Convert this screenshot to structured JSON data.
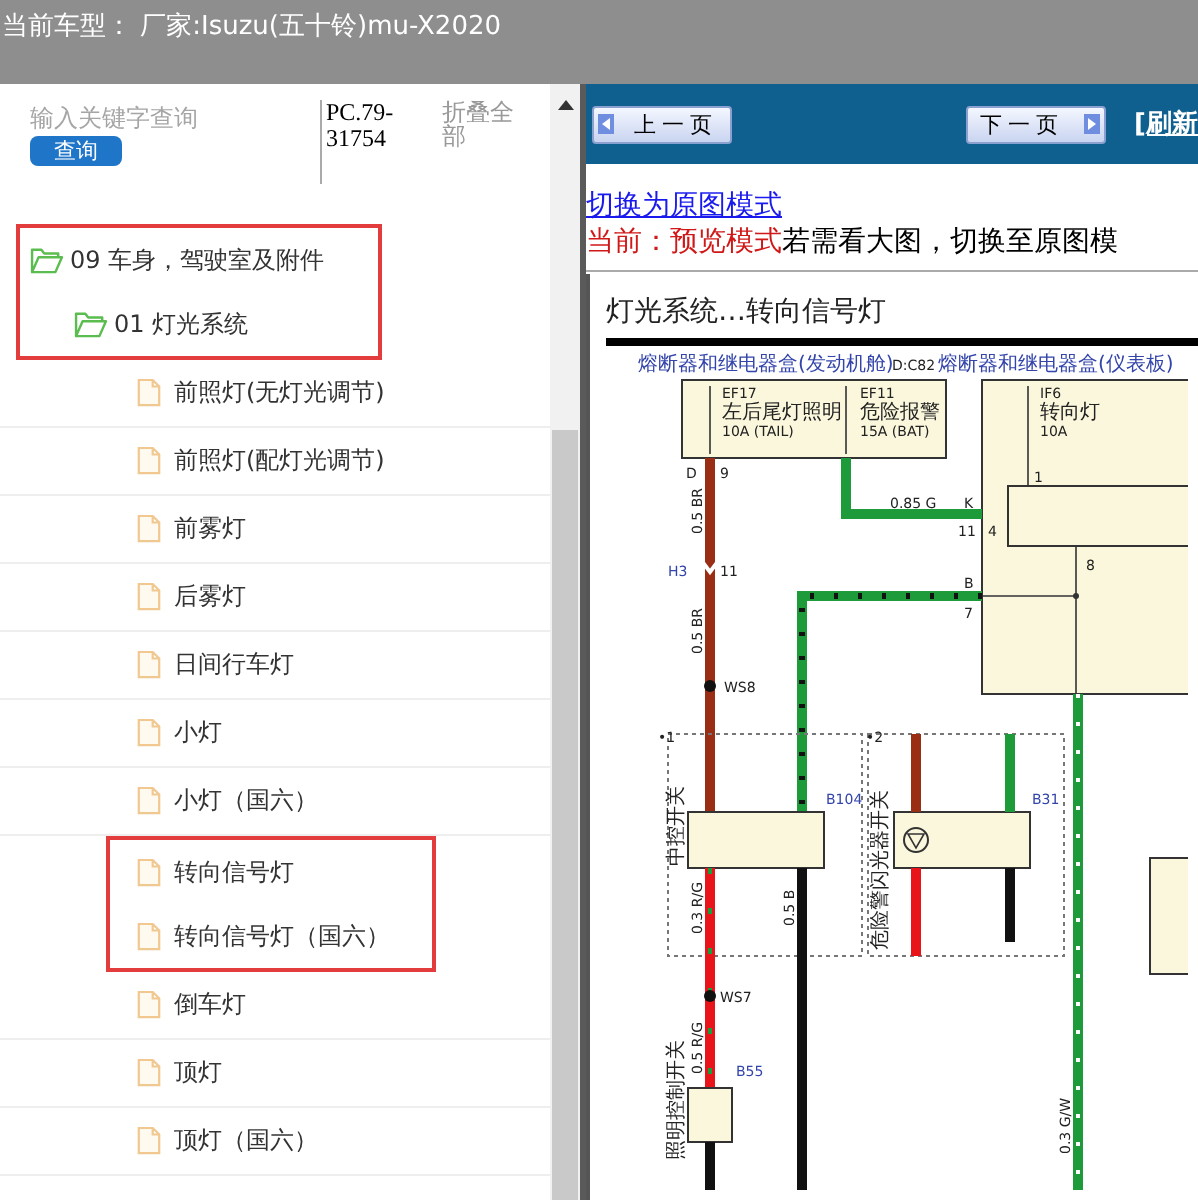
{
  "header": {
    "vehicle": "当前车型：  厂家:Isuzu(五十铃)mu-X2020"
  },
  "search": {
    "placeholder": "输入关键字查询",
    "button": "查询",
    "code": "PC.79-31754",
    "collapse": "折叠全部"
  },
  "tree": [
    {
      "label": "09 车身，驾驶室及附件",
      "kind": "folder",
      "expanded": true,
      "highlighted": true,
      "children": [
        {
          "label": "01 灯光系统",
          "kind": "folder",
          "expanded": true,
          "highlighted": true,
          "children": [
            {
              "label": "前照灯(无灯光调节)",
              "kind": "file",
              "highlighted": false
            },
            {
              "label": "前照灯(配灯光调节)",
              "kind": "file",
              "highlighted": false
            },
            {
              "label": "前雾灯",
              "kind": "file",
              "highlighted": false
            },
            {
              "label": "后雾灯",
              "kind": "file",
              "highlighted": false
            },
            {
              "label": "日间行车灯",
              "kind": "file",
              "highlighted": false
            },
            {
              "label": "小灯",
              "kind": "file",
              "highlighted": false
            },
            {
              "label": "小灯（国六）",
              "kind": "file",
              "highlighted": false
            },
            {
              "label": "转向信号灯",
              "kind": "file",
              "highlighted": true
            },
            {
              "label": "转向信号灯（国六）",
              "kind": "file",
              "highlighted": true
            },
            {
              "label": "倒车灯",
              "kind": "file",
              "highlighted": false
            },
            {
              "label": "顶灯",
              "kind": "file",
              "highlighted": false
            },
            {
              "label": "顶灯（国六）",
              "kind": "file",
              "highlighted": false
            }
          ]
        }
      ]
    }
  ],
  "toolbar": {
    "prev": "上一页",
    "next": "下一页",
    "refresh": "[刷新"
  },
  "mode": {
    "link": "切换为原图模式",
    "current": "当前：预览模式",
    "hint": "若需看大图，切换至原图模"
  },
  "diagram": {
    "title": "灯光系统…转向信号灯",
    "labels": [
      "熔断器和继电器盒(发动机舱)",
      "D:C82",
      "熔断器和继电器盒(仪表板)",
      "EF17",
      "左后尾灯照明",
      "10A (TAIL)",
      "EF11",
      "危险报警",
      "15A (BAT)",
      "IF6",
      "转向灯",
      "10A",
      "D",
      "9",
      "0.85 G",
      "K",
      "11",
      "4",
      "1",
      "8",
      "B",
      "7",
      "0.5 BR",
      "H3",
      "11",
      "0.5 BR",
      "WS8",
      "•1",
      "•2",
      "B104",
      "B31",
      "0.3 R/G",
      "0.5 B",
      "WS7",
      "0.5 R/G",
      "B55",
      "0.3 G/W",
      "中控开关",
      "危险警闪光器开关",
      "照明控制开关"
    ]
  }
}
